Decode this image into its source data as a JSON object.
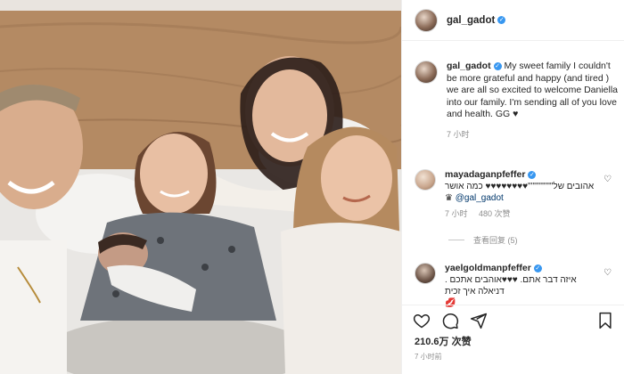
{
  "post": {
    "username": "gal_gadot",
    "verified_icon": "verified-badge-icon",
    "caption_text": "My sweet family     I couldn't be more grateful and happy (and tired     ) we are all so excited to welcome Daniella into our family. I'm sending all of you love and health. GG ♥",
    "caption_time": "7 小时"
  },
  "comments": [
    {
      "username": "mayadaganpfeffer",
      "text": "אהובים של\"\"\"\"\"\"\"\"♥♥♥♥♥♥♥♥ כמה אושר",
      "mention": "@gal_gadot",
      "mention_prefix": "♛",
      "time": "7 小时",
      "likes": "480 次赞",
      "view_replies": "查看回复 (5)"
    },
    {
      "username": "yaelgoldmanpfeffer",
      "text": "איזה דבר אתם. ♥♥♥אוהבים אתכם . דניאלה איך זכית",
      "extra": "💋"
    }
  ],
  "stats": {
    "likes": "210.6万 次赞",
    "time": "7 小时前"
  },
  "colors": {
    "accent": "#3897f0",
    "secondary_text": "#8e8e8e",
    "border": "#efefef"
  }
}
